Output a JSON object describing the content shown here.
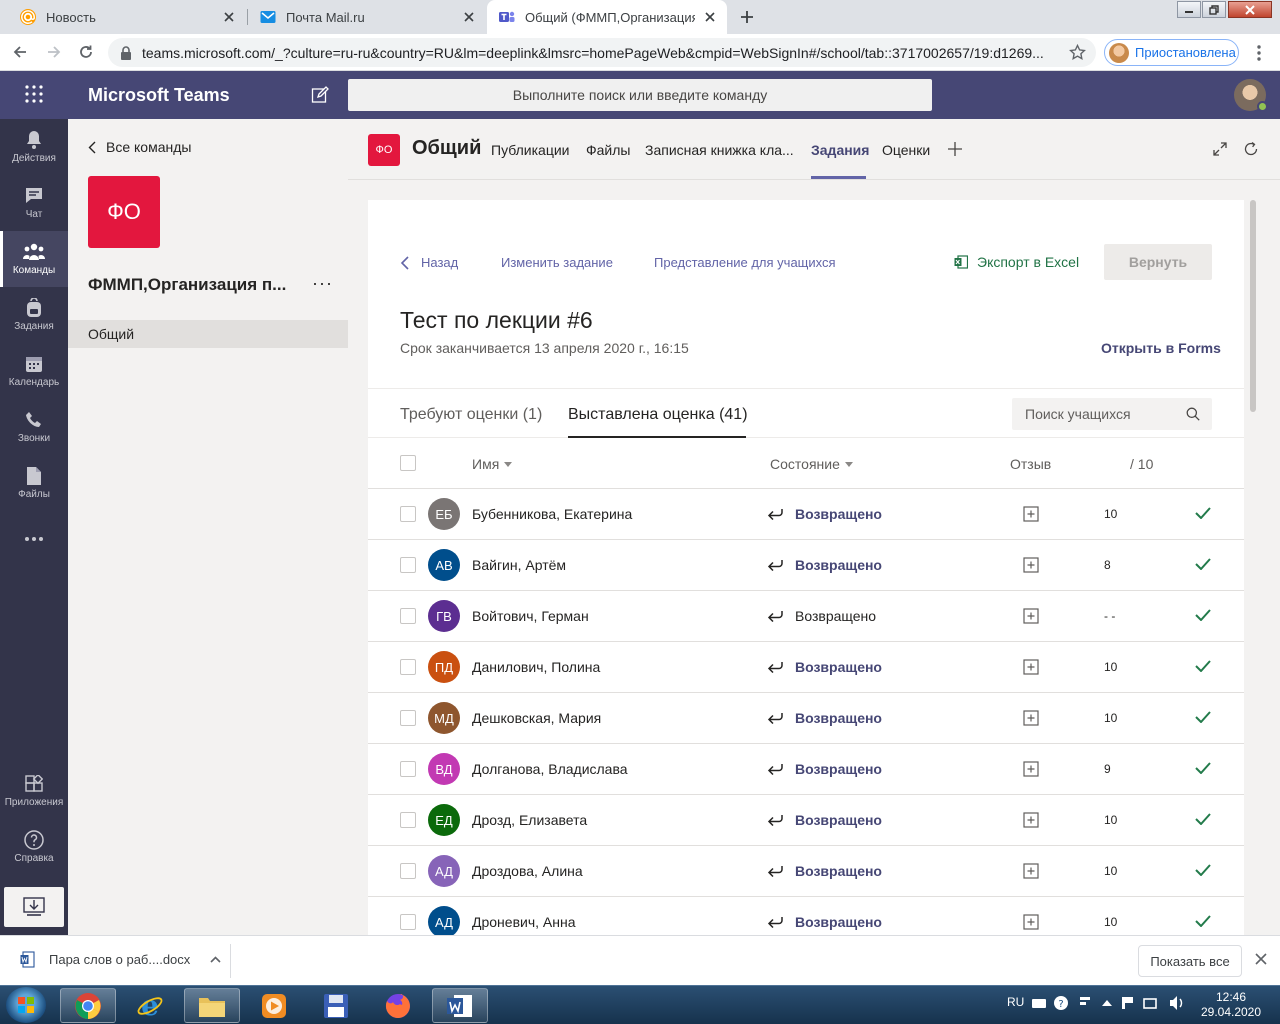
{
  "browser": {
    "tabs": [
      {
        "title": "Новость",
        "icon": "mailru-at-icon"
      },
      {
        "title": "Почта Mail.ru",
        "icon": "mail-envelope-icon"
      },
      {
        "title": "Общий (ФММП,Организация п",
        "icon": "teams-icon"
      }
    ],
    "url": "teams.microsoft.com/_?culture=ru-ru&country=RU&lm=deeplink&lmsrc=homePageWeb&cmpid=WebSignIn#/school/tab::3717002657/19:d1269...",
    "profile_label": "Приостановлена"
  },
  "teams": {
    "app_title": "Microsoft Teams",
    "search_placeholder": "Выполните поиск или введите команду"
  },
  "rail": [
    {
      "label": "Действия",
      "icon": "bell-icon"
    },
    {
      "label": "Чат",
      "icon": "chat-icon"
    },
    {
      "label": "Команды",
      "icon": "teams-people-icon",
      "active": true
    },
    {
      "label": "Задания",
      "icon": "backpack-icon"
    },
    {
      "label": "Календарь",
      "icon": "calendar-icon"
    },
    {
      "label": "Звонки",
      "icon": "phone-icon"
    },
    {
      "label": "Файлы",
      "icon": "file-icon"
    },
    {
      "label": "...",
      "icon": "more-icon"
    },
    {
      "label": "Приложения",
      "icon": "apps-icon"
    },
    {
      "label": "Справка",
      "icon": "help-icon"
    }
  ],
  "team_panel": {
    "back_label": "Все команды",
    "team_logo_text": "ФО",
    "team_name": "ФММП,Организация п...",
    "more": "···",
    "channel": "Общий"
  },
  "channel_header": {
    "badge": "ФО",
    "title": "Общий",
    "tabs": [
      "Публикации",
      "Файлы",
      "Записная книжка кла...",
      "Задания",
      "Оценки"
    ],
    "active_tab": "Задания"
  },
  "assignment": {
    "back": "Назад",
    "edit": "Изменить задание",
    "student_view": "Представление для учащихся",
    "export": "Экспорт в Excel",
    "return_button": "Вернуть",
    "title": "Тест по лекции #6",
    "due": "Срок заканчивается 13 апреля 2020 г., 16:15",
    "open_forms": "Открыть в Forms",
    "tab_needs_grading": "Требуют оценки (1)",
    "tab_graded": "Выставлена оценка (41)",
    "search_placeholder": "Поиск учащихся",
    "col_name": "Имя",
    "col_status": "Состояние",
    "col_feedback": "Отзыв",
    "col_points": "/ 10"
  },
  "students": [
    {
      "initials": "ЕБ",
      "name": "Бубенникова, Екатерина",
      "status": "Возвращено",
      "grade": "10",
      "color": "#7a7574",
      "emph": true
    },
    {
      "initials": "АВ",
      "name": "Вайгин, Артём",
      "status": "Возвращено",
      "grade": "8",
      "color": "#004e8c",
      "emph": true
    },
    {
      "initials": "ГВ",
      "name": "Войтович, Герман",
      "status": "Возвращено",
      "grade": "- -",
      "color": "#5c2e91",
      "emph": false
    },
    {
      "initials": "ПД",
      "name": "Данилович, Полина",
      "status": "Возвращено",
      "grade": "10",
      "color": "#ca5010",
      "emph": true
    },
    {
      "initials": "МД",
      "name": "Дешковская, Мария",
      "status": "Возвращено",
      "grade": "10",
      "color": "#8e562e",
      "emph": true
    },
    {
      "initials": "ВД",
      "name": "Долганова, Владислава",
      "status": "Возвращено",
      "grade": "9",
      "color": "#c239b3",
      "emph": true
    },
    {
      "initials": "ЕД",
      "name": "Дрозд, Елизавета",
      "status": "Возвращено",
      "grade": "10",
      "color": "#0b6a0b",
      "emph": true
    },
    {
      "initials": "АД",
      "name": "Дроздова, Алина",
      "status": "Возвращено",
      "grade": "10",
      "color": "#8764b8",
      "emph": true
    },
    {
      "initials": "АД",
      "name": "Дроневич, Анна",
      "status": "Возвращено",
      "grade": "10",
      "color": "#004e8c",
      "emph": true
    }
  ],
  "download_bar": {
    "file": "Пара слов о раб....docx",
    "show_all": "Показать все"
  },
  "taskbar": {
    "lang": "RU",
    "time": "12:46",
    "date": "29.04.2020"
  }
}
